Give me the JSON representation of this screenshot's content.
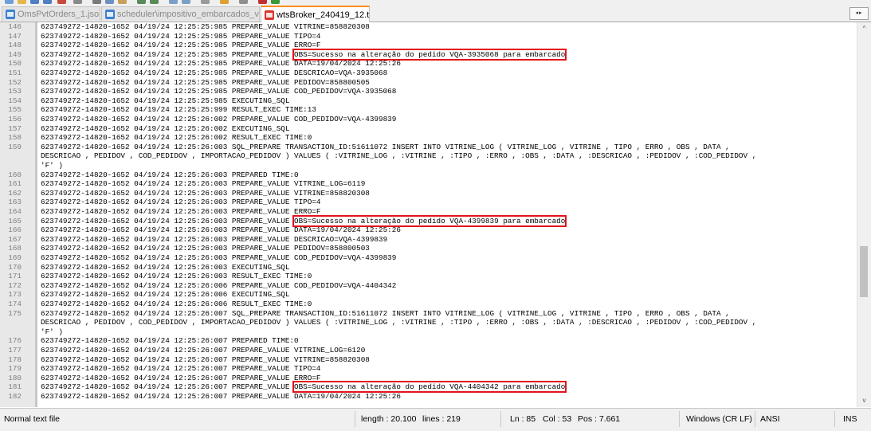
{
  "tabs": [
    {
      "label": "OmsPvtOrders_1.json",
      "icon": "blue-document-icon",
      "active": false
    },
    {
      "label": "scheduler\\impositivo_embarcados_vtex.ini",
      "icon": "blue-document-icon",
      "active": false
    },
    {
      "label": "wtsBroker_240419_12.txt",
      "icon": "red-document-icon",
      "active": true
    }
  ],
  "tab_close_glyph": "×",
  "tab_scroll_glyph": "◂▸",
  "highlight_color": "#e3131b",
  "active_tab_accent": "#fa8c18",
  "editor": {
    "lines": [
      {
        "n": "146",
        "t": "623749272-14820-1652 04/19/24 12:25:25:985 PREPARE_VALUE VITRINE=858820308"
      },
      {
        "n": "147",
        "t": "623749272-14820-1652 04/19/24 12:25:25:985 PREPARE_VALUE TIPO=4"
      },
      {
        "n": "148",
        "t": "623749272-14820-1652 04/19/24 12:25:25:985 PREPARE_VALUE ERRO=F"
      },
      {
        "n": "149",
        "t": "623749272-14820-1652 04/19/24 12:25:25:985 PREPARE_VALUE ",
        "h": "OBS=Sucesso na alteração do pedido VQA-3935068 para embarcado"
      },
      {
        "n": "150",
        "t": "623749272-14820-1652 04/19/24 12:25:25:985 PREPARE_VALUE DATA=19/04/2024 12:25:26"
      },
      {
        "n": "151",
        "t": "623749272-14820-1652 04/19/24 12:25:25:985 PREPARE_VALUE DESCRICAO=VQA-3935068"
      },
      {
        "n": "152",
        "t": "623749272-14820-1652 04/19/24 12:25:25:985 PREPARE_VALUE PEDIDOV=858800505"
      },
      {
        "n": "153",
        "t": "623749272-14820-1652 04/19/24 12:25:25:985 PREPARE_VALUE COD_PEDIDOV=VQA-3935068"
      },
      {
        "n": "154",
        "t": "623749272-14820-1652 04/19/24 12:25:25:985 EXECUTING_SQL"
      },
      {
        "n": "155",
        "t": "623749272-14820-1652 04/19/24 12:25:25:999 RESULT_EXEC TIME:13"
      },
      {
        "n": "156",
        "t": "623749272-14820-1652 04/19/24 12:25:26:002 PREPARE_VALUE COD_PEDIDOV=VQA-4399839"
      },
      {
        "n": "157",
        "t": "623749272-14820-1652 04/19/24 12:25:26:002 EXECUTING_SQL"
      },
      {
        "n": "158",
        "t": "623749272-14820-1652 04/19/24 12:25:26:002 RESULT_EXEC TIME:0"
      },
      {
        "n": "159",
        "t": "623749272-14820-1652 04/19/24 12:25:26:003 SQL_PREPARE TRANSACTION_ID:51611072 INSERT INTO VITRINE_LOG ( VITRINE_LOG , VITRINE , TIPO , ERRO , OBS , DATA ,"
      },
      {
        "n": "",
        "t": "DESCRICAO , PEDIDOV , COD_PEDIDOV , IMPORTACAO_PEDIDOV ) VALUES ( :VITRINE_LOG , :VITRINE , :TIPO , :ERRO , :OBS , :DATA , :DESCRICAO , :PEDIDOV , :COD_PEDIDOV ,"
      },
      {
        "n": "",
        "t": "'F' )"
      },
      {
        "n": "160",
        "t": "623749272-14820-1652 04/19/24 12:25:26:003 PREPARED TIME:0"
      },
      {
        "n": "161",
        "t": "623749272-14820-1652 04/19/24 12:25:26:003 PREPARE_VALUE VITRINE_LOG=6119"
      },
      {
        "n": "162",
        "t": "623749272-14820-1652 04/19/24 12:25:26:003 PREPARE_VALUE VITRINE=858820308"
      },
      {
        "n": "163",
        "t": "623749272-14820-1652 04/19/24 12:25:26:003 PREPARE_VALUE TIPO=4"
      },
      {
        "n": "164",
        "t": "623749272-14820-1652 04/19/24 12:25:26:003 PREPARE_VALUE ERRO=F"
      },
      {
        "n": "165",
        "t": "623749272-14820-1652 04/19/24 12:25:26:003 PREPARE_VALUE ",
        "h": "OBS=Sucesso na alteração do pedido VQA-4399839 para embarcado"
      },
      {
        "n": "166",
        "t": "623749272-14820-1652 04/19/24 12:25:26:003 PREPARE_VALUE DATA=19/04/2024 12:25:26"
      },
      {
        "n": "167",
        "t": "623749272-14820-1652 04/19/24 12:25:26:003 PREPARE_VALUE DESCRICAO=VQA-4399839"
      },
      {
        "n": "168",
        "t": "623749272-14820-1652 04/19/24 12:25:26:003 PREPARE_VALUE PEDIDOV=858800503"
      },
      {
        "n": "169",
        "t": "623749272-14820-1652 04/19/24 12:25:26:003 PREPARE_VALUE COD_PEDIDOV=VQA-4399839"
      },
      {
        "n": "170",
        "t": "623749272-14820-1652 04/19/24 12:25:26:003 EXECUTING_SQL"
      },
      {
        "n": "171",
        "t": "623749272-14820-1652 04/19/24 12:25:26:003 RESULT_EXEC TIME:0"
      },
      {
        "n": "172",
        "t": "623749272-14820-1652 04/19/24 12:25:26:006 PREPARE_VALUE COD_PEDIDOV=VQA-4404342"
      },
      {
        "n": "173",
        "t": "623749272-14820-1652 04/19/24 12:25:26:006 EXECUTING_SQL"
      },
      {
        "n": "174",
        "t": "623749272-14820-1652 04/19/24 12:25:26:006 RESULT_EXEC TIME:0"
      },
      {
        "n": "175",
        "t": "623749272-14820-1652 04/19/24 12:25:26:007 SQL_PREPARE TRANSACTION_ID:51611072 INSERT INTO VITRINE_LOG ( VITRINE_LOG , VITRINE , TIPO , ERRO , OBS , DATA ,"
      },
      {
        "n": "",
        "t": "DESCRICAO , PEDIDOV , COD_PEDIDOV , IMPORTACAO_PEDIDOV ) VALUES ( :VITRINE_LOG , :VITRINE , :TIPO , :ERRO , :OBS , :DATA , :DESCRICAO , :PEDIDOV , :COD_PEDIDOV ,"
      },
      {
        "n": "",
        "t": "'F' )"
      },
      {
        "n": "176",
        "t": "623749272-14820-1652 04/19/24 12:25:26:007 PREPARED TIME:0"
      },
      {
        "n": "177",
        "t": "623749272-14820-1652 04/19/24 12:25:26:007 PREPARE_VALUE VITRINE_LOG=6120"
      },
      {
        "n": "178",
        "t": "623749272-14820-1652 04/19/24 12:25:26:007 PREPARE_VALUE VITRINE=858820308"
      },
      {
        "n": "179",
        "t": "623749272-14820-1652 04/19/24 12:25:26:007 PREPARE_VALUE TIPO=4"
      },
      {
        "n": "180",
        "t": "623749272-14820-1652 04/19/24 12:25:26:007 PREPARE_VALUE ERRO=F"
      },
      {
        "n": "181",
        "t": "623749272-14820-1652 04/19/24 12:25:26:007 PREPARE_VALUE ",
        "h": "OBS=Sucesso na alteração do pedido VQA-4404342 para embarcado"
      },
      {
        "n": "182",
        "t": "623749272-14820-1652 04/19/24 12:25:26:007 PREPARE_VALUE DATA=19/04/2024 12:25:26"
      }
    ]
  },
  "scrollbar": {
    "up_glyph": "^",
    "down_glyph": "v"
  },
  "status": {
    "file_type": "Normal text file",
    "length": "length : 20.100",
    "lines": "lines : 219",
    "ln": "Ln : 85",
    "col": "Col : 53",
    "pos": "Pos : 7.661",
    "eol": "Windows (CR LF)",
    "encoding": "ANSI",
    "mode": "INS"
  }
}
